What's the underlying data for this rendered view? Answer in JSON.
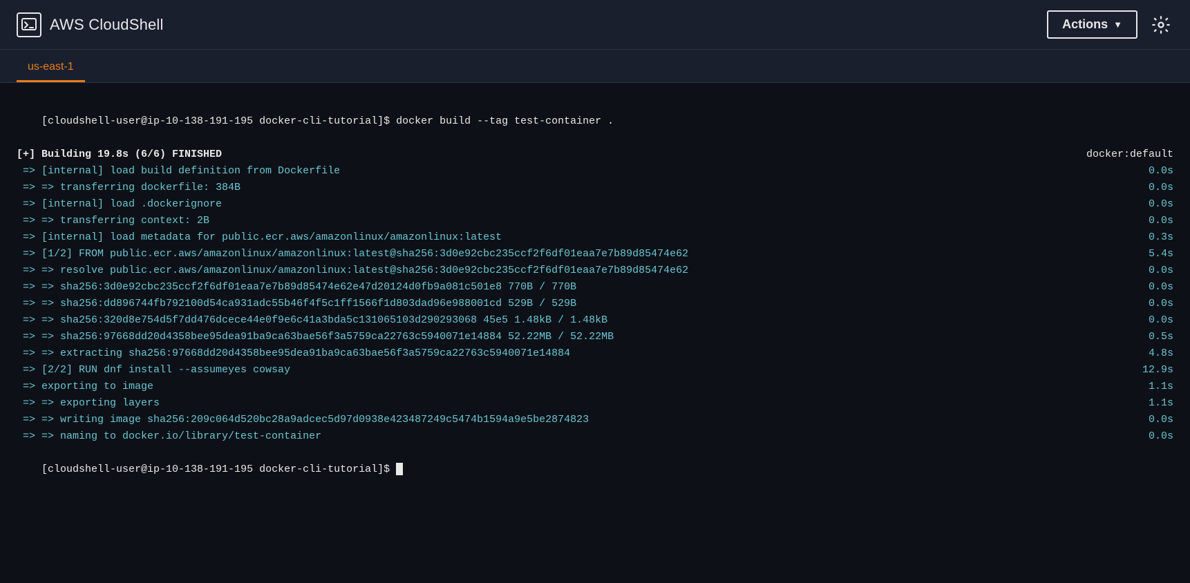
{
  "header": {
    "icon_symbol": "⬡",
    "title": "AWS CloudShell",
    "actions_label": "Actions",
    "actions_chevron": "▼",
    "settings_icon": "⚙"
  },
  "tabs": [
    {
      "label": "us-east-1",
      "active": true
    }
  ],
  "terminal": {
    "lines": [
      {
        "id": 1,
        "type": "command",
        "text": "[cloudshell-user@ip-10-138-191-195 docker-cli-tutorial]$ docker build --tag test-container ."
      },
      {
        "id": 2,
        "type": "build_header_left",
        "text": "[+] Building 19.8s (6/6) FINISHED",
        "right": "docker:default"
      },
      {
        "id": 3,
        "type": "build_step",
        "text": " => [internal] load build definition from Dockerfile",
        "right": "0.0s"
      },
      {
        "id": 4,
        "type": "build_step",
        "text": " => => transferring dockerfile: 384B",
        "right": "0.0s"
      },
      {
        "id": 5,
        "type": "build_step",
        "text": " => [internal] load .dockerignore",
        "right": "0.0s"
      },
      {
        "id": 6,
        "type": "build_step",
        "text": " => => transferring context: 2B",
        "right": "0.0s"
      },
      {
        "id": 7,
        "type": "build_step",
        "text": " => [internal] load metadata for public.ecr.aws/amazonlinux/amazonlinux:latest",
        "right": "0.3s"
      },
      {
        "id": 8,
        "type": "build_step",
        "text": " => [1/2] FROM public.ecr.aws/amazonlinux/amazonlinux:latest@sha256:3d0e92cbc235ccf2f6df01eaa7e7b89d85474e62",
        "right": "5.4s"
      },
      {
        "id": 9,
        "type": "build_step",
        "text": " => => resolve public.ecr.aws/amazonlinux/amazonlinux:latest@sha256:3d0e92cbc235ccf2f6df01eaa7e7b89d85474e62",
        "right": "0.0s"
      },
      {
        "id": 10,
        "type": "build_step",
        "text": " => => sha256:3d0e92cbc235ccf2f6df01eaa7e7b89d85474e62e47d20124d0fb9a081c501e8 770B / 770B",
        "right": "0.0s"
      },
      {
        "id": 11,
        "type": "build_step",
        "text": " => => sha256:dd896744fb792100d54ca931adc55b46f4f5c1ff1566f1d803dad96e988001cd 529B / 529B",
        "right": "0.0s"
      },
      {
        "id": 12,
        "type": "build_step",
        "text": " => => sha256:320d8e754d5f7dd476dcece44e0f9e6c41a3bda5c131065103d290293068 45e5 1.48kB / 1.48kB",
        "right": "0.0s"
      },
      {
        "id": 13,
        "type": "build_step",
        "text": " => => sha256:97668dd20d4358bee95dea91ba9ca63bae56f3a5759ca22763c5940071e14884 52.22MB / 52.22MB",
        "right": "0.5s"
      },
      {
        "id": 14,
        "type": "build_step",
        "text": " => => extracting sha256:97668dd20d4358bee95dea91ba9ca63bae56f3a5759ca22763c5940071e14884",
        "right": "4.8s"
      },
      {
        "id": 15,
        "type": "build_step",
        "text": " => [2/2] RUN dnf install --assumeyes cowsay",
        "right": "12.9s"
      },
      {
        "id": 16,
        "type": "build_step",
        "text": " => exporting to image",
        "right": "1.1s"
      },
      {
        "id": 17,
        "type": "build_step",
        "text": " => => exporting layers",
        "right": "1.1s"
      },
      {
        "id": 18,
        "type": "build_step",
        "text": " => => writing image sha256:209c064d520bc28a9adcec5d97d0938e423487249c5474b1594a9e5be2874823",
        "right": "0.0s"
      },
      {
        "id": 19,
        "type": "build_step",
        "text": " => => naming to docker.io/library/test-container",
        "right": "0.0s"
      },
      {
        "id": 20,
        "type": "prompt",
        "text": "[cloudshell-user@ip-10-138-191-195 docker-cli-tutorial]$ "
      }
    ]
  }
}
